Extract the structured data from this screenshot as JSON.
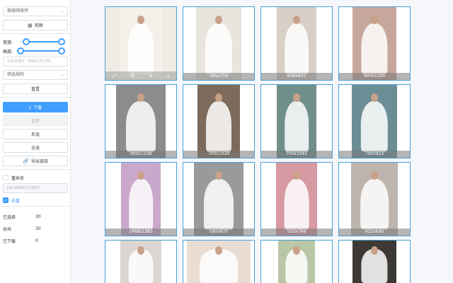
{
  "sidebar": {
    "sort_select": "按原网排序",
    "view_button": "视图",
    "width_label": "宽度:",
    "height_label": "高度:",
    "keyword_placeholder": "包含关键字（使用逗号分隔）",
    "filter_select": "筛选规则",
    "reset_button": "重置",
    "download_button": "下载",
    "pause_button": "暂停",
    "invert_button": "反选",
    "select_all_button": "全选",
    "export_button": "导出链接",
    "rename_label": "重命名",
    "rename_template": "[#] [NO001] [EXT]",
    "dedupe_label": "去重",
    "stats": [
      {
        "label": "已选择",
        "value": "30"
      },
      {
        "label": "总共",
        "value": "30"
      },
      {
        "label": "已下载",
        "value": "0"
      }
    ]
  },
  "cards": [
    {
      "dim": "",
      "bg": "#efece6",
      "img": "#f3f0ea"
    },
    {
      "dim": "585x750",
      "bg": "#ffffff",
      "img": "#e8e4de"
    },
    {
      "dim": "648x903",
      "bg": "#ffffff",
      "img": "#d8cfc6"
    },
    {
      "dim": "900x1200",
      "bg": "#ffffff",
      "img": "#c7a79b"
    },
    {
      "dim": "900x1328",
      "bg": "#ffffff",
      "img": "#8c8c8c"
    },
    {
      "dim": "700x1029",
      "bg": "#ffffff",
      "img": "#7d6a5a"
    },
    {
      "dim": "700x1045",
      "bg": "#ffffff",
      "img": "#6f8f8a"
    },
    {
      "dim": "700x933",
      "bg": "#ffffff",
      "img": "#6b8e96"
    },
    {
      "dim": "1488x1985",
      "bg": "#ffffff",
      "img": "#c9a8cc"
    },
    {
      "dim": "580x870",
      "bg": "#ffffff",
      "img": "#9a9a9a"
    },
    {
      "dim": "510x766",
      "bg": "#ffffff",
      "img": "#d79aa2"
    },
    {
      "dim": "422x640",
      "bg": "#ffffff",
      "img": "#bdb5ad"
    },
    {
      "dim": "",
      "bg": "#ffffff",
      "img": "#dcd6d2"
    },
    {
      "dim": "",
      "bg": "#ffffff",
      "img": "#e9ddd3"
    },
    {
      "dim": "",
      "bg": "#ffffff",
      "img": "#b9c7a8"
    },
    {
      "dim": "",
      "bg": "#ffffff",
      "img": "#3d3a36"
    }
  ],
  "tool_icons": [
    "expand-icon",
    "link-off-icon",
    "link-icon",
    "download-icon"
  ]
}
